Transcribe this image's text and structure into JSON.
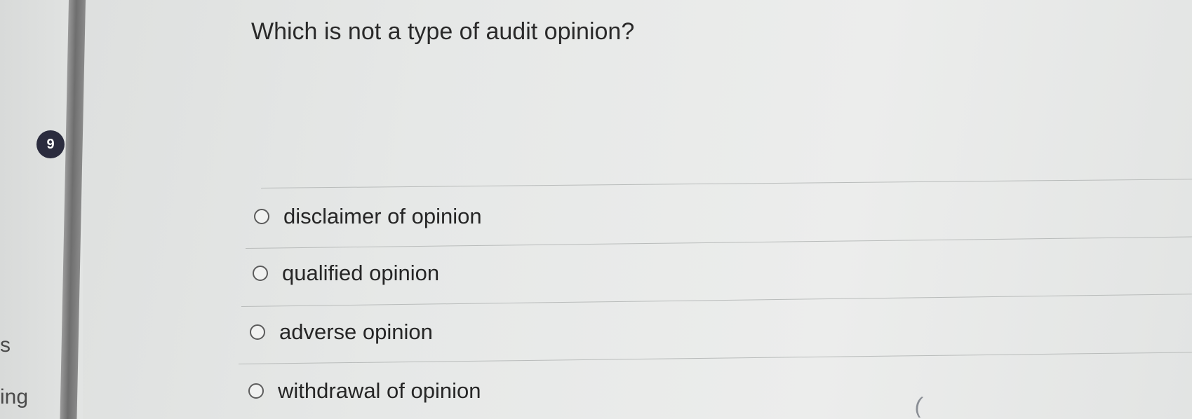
{
  "sidebar": {
    "partial_text_top": "s",
    "partial_text_bottom": "ing"
  },
  "question": {
    "number": "9",
    "text": "Which is not a type of audit opinion?"
  },
  "options": [
    {
      "label": "disclaimer of opinion"
    },
    {
      "label": "qualified opinion"
    },
    {
      "label": "adverse opinion"
    },
    {
      "label": "withdrawal of opinion"
    }
  ],
  "stray_mark": "("
}
